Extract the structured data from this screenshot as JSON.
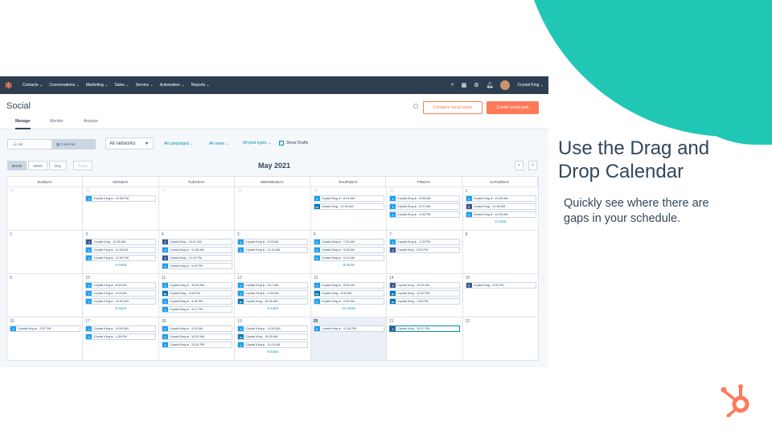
{
  "colors": {
    "accent": "#20c7b5",
    "brand": "#ff7a59",
    "nav": "#2d3e50",
    "link": "#0091ae"
  },
  "slide": {
    "headline": "Use the Drag and Drop Calendar",
    "subtext": "Quickly see where there are gaps in your schedule.",
    "logo_icon": "hubspot-sprocket-icon"
  },
  "topnav": {
    "logo": "hubspot-logo-icon",
    "items": [
      "Contacts ⌄",
      "Conversations ⌄",
      "Marketing ⌄",
      "Sales ⌄",
      "Service ⌄",
      "Automation ⌄",
      "Reports ⌄"
    ],
    "user": "Crystal King ⌄"
  },
  "app": {
    "title": "Social",
    "compare_button": "Compare social posts",
    "create_button": "Create social post",
    "tabs": [
      "Manage",
      "Monitor",
      "Analyze"
    ]
  },
  "filters": {
    "view_list": "List",
    "view_calendar": "Calendar",
    "networks": "All networks",
    "campaigns": "All campaigns ⌄",
    "users": "All users ⌄",
    "post_types": "All post types ⌄",
    "show_drafts": "Show Drafts"
  },
  "calendar": {
    "view_buttons": [
      "Month",
      "Week",
      "Day",
      "Today"
    ],
    "month_title": "May 2021",
    "prev": "‹",
    "next": "›",
    "weekdays": [
      "SUNDAY",
      "MONDAY",
      "TUESDAY",
      "WEDNESDAY",
      "THURSDAY",
      "FRIDAY",
      "SATURDAY"
    ],
    "weeks": [
      [
        {
          "n": "25",
          "faded": true,
          "posts": []
        },
        {
          "n": "26",
          "faded": true,
          "posts": [
            [
              "tw",
              "Crystal King ● - 12:38 PM"
            ]
          ]
        },
        {
          "n": "27",
          "faded": true,
          "posts": []
        },
        {
          "n": "28",
          "faded": true,
          "posts": []
        },
        {
          "n": "29",
          "faded": true,
          "posts": [
            [
              "tw",
              "Crystal King ● - 8:24 AM"
            ],
            [
              "li",
              "Crystal King - 10:04 AM"
            ]
          ]
        },
        {
          "n": "30",
          "faded": true,
          "posts": [
            [
              "tw",
              "Crystal King ● - 8:06 AM"
            ],
            [
              "tw",
              "Crystal King ● - 8:47 AM"
            ],
            [
              "tw",
              "Crystal King ● - 4:56 PM"
            ]
          ]
        },
        {
          "n": "1",
          "posts": [
            [
              "tw",
              "Crystal King ● - 11:08 AM"
            ],
            [
              "fb",
              "Crystal King - 11:08 AM"
            ],
            [
              "tw",
              "Crystal King ● - 11:39 AM"
            ]
          ],
          "more": "2 more"
        }
      ],
      [
        {
          "n": "2",
          "posts": []
        },
        {
          "n": "3",
          "posts": [
            [
              "fb",
              "Crystal King - 10:35 AM"
            ],
            [
              "tw",
              "Crystal King ● - 11:35 AM"
            ],
            [
              "tw",
              "Crystal King ● - 12:39 PM"
            ]
          ],
          "more": "4 more"
        },
        {
          "n": "4",
          "posts": [
            [
              "fb",
              "Crystal King - 10:07 AM"
            ],
            [
              "tw",
              "Crystal King ● - 11:35 AM"
            ],
            [
              "fb",
              "Crystal King - 12:10 PM"
            ],
            [
              "tw",
              "Crystal King ● - 5:19 PM"
            ]
          ]
        },
        {
          "n": "5",
          "posts": [
            [
              "tw",
              "Crystal King ● - 9:29 AM"
            ],
            [
              "tw",
              "Crystal King ● - 11:42 AM"
            ]
          ]
        },
        {
          "n": "6",
          "posts": [
            [
              "tw",
              "Crystal King ● - 7:29 AM"
            ],
            [
              "tw",
              "Crystal King ● - 9:28 AM"
            ],
            [
              "tw",
              "Crystal King ● - 9:41 AM"
            ]
          ],
          "more": "8 more"
        },
        {
          "n": "7",
          "posts": [
            [
              "tw",
              "Crystal King ● - 1:33 PM"
            ],
            [
              "fb",
              "Crystal King - 3:03 PM"
            ]
          ]
        },
        {
          "n": "8",
          "posts": []
        }
      ],
      [
        {
          "n": "9",
          "posts": []
        },
        {
          "n": "10",
          "posts": [
            [
              "tw",
              "Crystal King ● - 8:32 AM"
            ],
            [
              "tw",
              "Crystal King ● - 9:29 AM"
            ],
            [
              "tw",
              "Crystal King ● - 10:02 AM"
            ]
          ],
          "more": "5 more"
        },
        {
          "n": "11",
          "posts": [
            [
              "tw",
              "Crystal King ● - 10:04 AM"
            ],
            [
              "li",
              "Crystal King - 3:18 PM"
            ],
            [
              "tw",
              "Crystal King ● - 3:18 PM"
            ],
            [
              "tw",
              "Crystal King ● - 3:27 PM"
            ]
          ]
        },
        {
          "n": "12",
          "posts": [
            [
              "tw",
              "Crystal King ● - 8:17 AM"
            ],
            [
              "tw",
              "Crystal King ● - 9:36 AM"
            ],
            [
              "li",
              "Crystal King - 10:06 AM"
            ]
          ],
          "more": "4 more"
        },
        {
          "n": "13",
          "posts": [
            [
              "tw",
              "Crystal King ● - 8:00 AM"
            ],
            [
              "li",
              "Crystal King - 8:30 AM"
            ],
            [
              "tw",
              "Crystal King ● - 9:35 AM"
            ]
          ],
          "more": "12 more"
        },
        {
          "n": "14",
          "posts": [
            [
              "fb",
              "Crystal King - 10:32 AM"
            ],
            [
              "li",
              "Crystal King - 12:40 PM"
            ],
            [
              "li",
              "Crystal King - 1:50 PM"
            ]
          ]
        },
        {
          "n": "15",
          "posts": [
            [
              "fb",
              "Crystal King - 4:02 PM"
            ]
          ]
        }
      ],
      [
        {
          "n": "16",
          "posts": [
            [
              "tw",
              "Crystal King ● - 2:57 PM"
            ]
          ]
        },
        {
          "n": "17",
          "posts": [
            [
              "tw",
              "Crystal King ● - 10:09 AM"
            ],
            [
              "tw",
              "Crystal King ● - 1:39 PM"
            ]
          ]
        },
        {
          "n": "18",
          "posts": [
            [
              "tw",
              "Crystal King ● - 9:29 AM"
            ],
            [
              "tw",
              "Crystal King ● - 10:31 AM"
            ],
            [
              "tw",
              "Crystal King ● - 12:04 PM"
            ]
          ]
        },
        {
          "n": "19",
          "posts": [
            [
              "tw",
              "Crystal King ● - 10:00 AM"
            ],
            [
              "li",
              "Crystal King - 10:05 AM"
            ],
            [
              "tw",
              "Crystal King ● - 11:03 AM"
            ]
          ],
          "more": "6 more"
        },
        {
          "n": "20",
          "today": true,
          "posts": [
            [
              "tw",
              "Crystal King ● - 12:36 PM"
            ]
          ]
        },
        {
          "n": "21",
          "posts": [
            [
              "fb",
              "Crystal King - 12:37 PM"
            ]
          ],
          "selected": true
        },
        {
          "n": "22",
          "posts": []
        }
      ]
    ]
  }
}
